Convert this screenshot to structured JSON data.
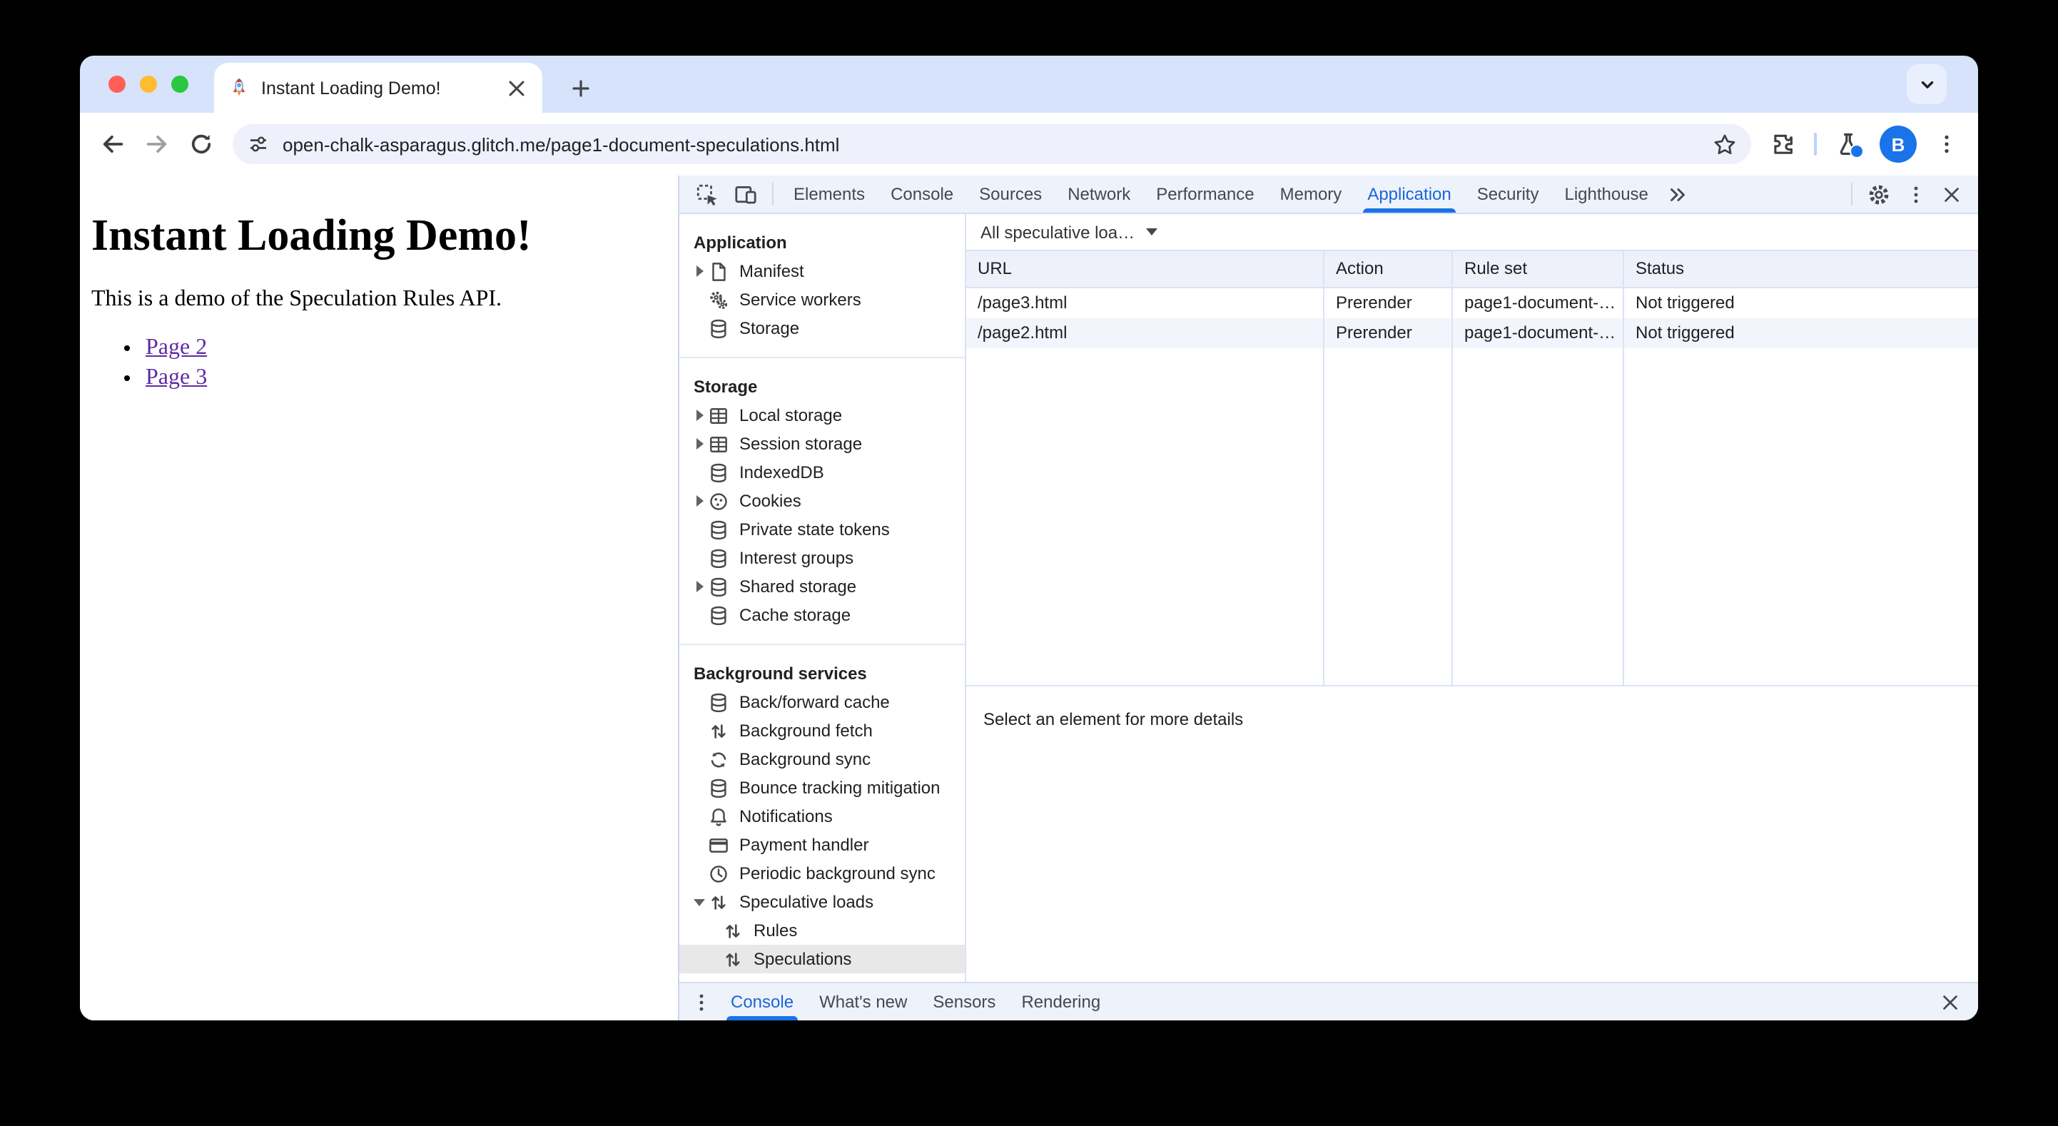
{
  "browser": {
    "tab": {
      "title": "Instant Loading Demo!"
    },
    "address_bar": {
      "url": "open-chalk-asparagus.glitch.me/page1-document-speculations.html"
    },
    "avatar_initial": "B"
  },
  "page": {
    "heading": "Instant Loading Demo!",
    "paragraph": "This is a demo of the Speculation Rules API.",
    "links": [
      "Page 2",
      "Page 3"
    ]
  },
  "devtools": {
    "tabs": [
      "Elements",
      "Console",
      "Sources",
      "Network",
      "Performance",
      "Memory",
      "Application",
      "Security",
      "Lighthouse"
    ],
    "active_tab": "Application",
    "sidebar": {
      "sections": [
        {
          "title": "Application",
          "items": [
            {
              "label": "Manifest"
            },
            {
              "label": "Service workers"
            },
            {
              "label": "Storage"
            }
          ]
        },
        {
          "title": "Storage",
          "items": [
            {
              "label": "Local storage"
            },
            {
              "label": "Session storage"
            },
            {
              "label": "IndexedDB"
            },
            {
              "label": "Cookies"
            },
            {
              "label": "Private state tokens"
            },
            {
              "label": "Interest groups"
            },
            {
              "label": "Shared storage"
            },
            {
              "label": "Cache storage"
            }
          ]
        },
        {
          "title": "Background services",
          "items": [
            {
              "label": "Back/forward cache"
            },
            {
              "label": "Background fetch"
            },
            {
              "label": "Background sync"
            },
            {
              "label": "Bounce tracking mitigation"
            },
            {
              "label": "Notifications"
            },
            {
              "label": "Payment handler"
            },
            {
              "label": "Periodic background sync"
            },
            {
              "label": "Speculative loads"
            },
            {
              "label": "Rules"
            },
            {
              "label": "Speculations"
            }
          ]
        }
      ]
    },
    "filter": {
      "label": "All speculative loa…"
    },
    "table": {
      "columns": [
        "URL",
        "Action",
        "Rule set",
        "Status"
      ],
      "rows": [
        {
          "url": "/page3.html",
          "action": "Prerender",
          "rule_set": "page1-document-…",
          "status": "Not triggered"
        },
        {
          "url": "/page2.html",
          "action": "Prerender",
          "rule_set": "page1-document-…",
          "status": "Not triggered"
        }
      ]
    },
    "details_placeholder": "Select an element for more details",
    "drawer": {
      "tabs": [
        "Console",
        "What's new",
        "Sensors",
        "Rendering"
      ],
      "active": "Console"
    },
    "accent_color": "#1a73e8"
  }
}
